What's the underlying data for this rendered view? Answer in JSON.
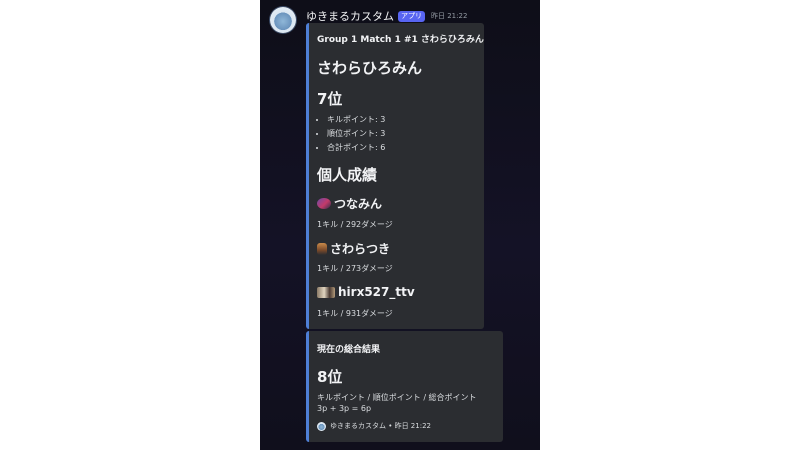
{
  "message": {
    "author": "ゆきまるカスタム",
    "badge": "アプリ",
    "timestamp": "昨日 21:22"
  },
  "embed1": {
    "author_line": "Group 1 Match 1 #1 さわらひろみん",
    "title": "さわらひろみん",
    "rank": "7位",
    "points": [
      "キルポイント: 3",
      "順位ポイント: 3",
      "合計ポイント: 6"
    ],
    "section_title": "個人成績",
    "players": [
      {
        "name": "つなみん",
        "stats": "1キル / 292ダメージ"
      },
      {
        "name": "さわらつき",
        "stats": "1キル / 273ダメージ"
      },
      {
        "name": "hirx527_ttv",
        "stats": "1キル / 931ダメージ"
      }
    ]
  },
  "embed2": {
    "title": "現在の総合結果",
    "rank": "8位",
    "points_header": "キルポイント / 順位ポイント / 総合ポイント",
    "points_calc": "3p + 3p = 6p",
    "footer_text": "ゆきまるカスタム • 昨日 21:22"
  },
  "colors": {
    "embed_border": "#4e7fd6",
    "embed_bg": "#2b2d31",
    "badge": "#5865f2"
  }
}
